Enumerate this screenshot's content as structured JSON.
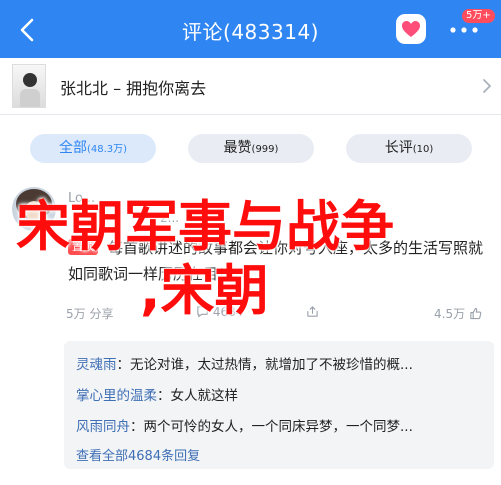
{
  "header": {
    "title": "评论(483314)",
    "badge": "5万+",
    "colors": {
      "bar": "#2f86f2",
      "badge": "#ff4d5e"
    }
  },
  "song": {
    "title": "张北北 – 拥抱你离去"
  },
  "tabs": [
    {
      "label": "全部",
      "count": "(48.3万)",
      "active": true
    },
    {
      "label": "最赞",
      "count": "(999)",
      "active": false
    },
    {
      "label": "长评",
      "count": "(10)",
      "active": false
    }
  ],
  "comment": {
    "name": "Lo...",
    "date": "2...",
    "badge": "置顶",
    "text": "每首歌讲述的故事都会让你对号入座，太多的生活写照就如同歌词一样历历在目！",
    "share_label": "分享",
    "share_count": "5万",
    "reply_count": "4684",
    "like_count": "4.5万"
  },
  "replies": [
    {
      "who": "灵魂雨",
      "text": "无论对谁，太过热情，就增加了不被珍惜的概..."
    },
    {
      "who": "掌心里的温柔",
      "text": "女人就这样"
    },
    {
      "who": "风雨同舟",
      "text": "两个可怜的女人，一个同床异梦，一个同梦..."
    }
  ],
  "view_all": "查看全部4684条回复",
  "overlay": {
    "line1": "宋朝军事与战争",
    "line2": ",宋朝",
    "color": "#ff0d0d"
  }
}
